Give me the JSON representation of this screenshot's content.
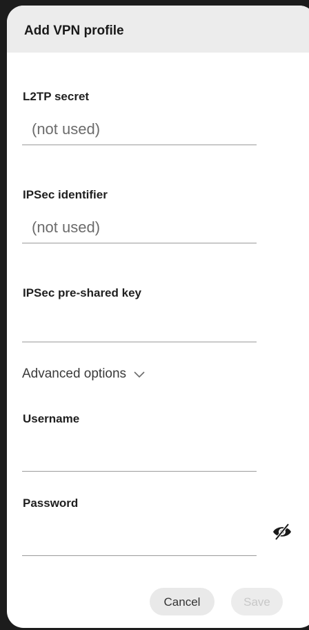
{
  "dialog": {
    "title": "Add VPN profile"
  },
  "fields": {
    "l2tp_secret": {
      "label": "L2TP secret",
      "placeholder": "(not used)"
    },
    "ipsec_identifier": {
      "label": "IPSec identifier",
      "placeholder": "(not used)"
    },
    "ipsec_psk": {
      "label": "IPSec pre-shared key",
      "placeholder": ""
    },
    "username": {
      "label": "Username",
      "placeholder": ""
    },
    "password": {
      "label": "Password",
      "placeholder": ""
    }
  },
  "advanced_options": {
    "label": "Advanced options",
    "icon": "chevron-down-icon"
  },
  "password_toggle": {
    "icon": "eye-off-icon"
  },
  "buttons": {
    "cancel": "Cancel",
    "save": "Save"
  },
  "colors": {
    "header_bg": "#ececec",
    "dialog_bg": "#ffffff",
    "underline": "#9a9a9a",
    "button_bg": "#e9e9e9",
    "disabled_text": "#c8c8c8"
  }
}
